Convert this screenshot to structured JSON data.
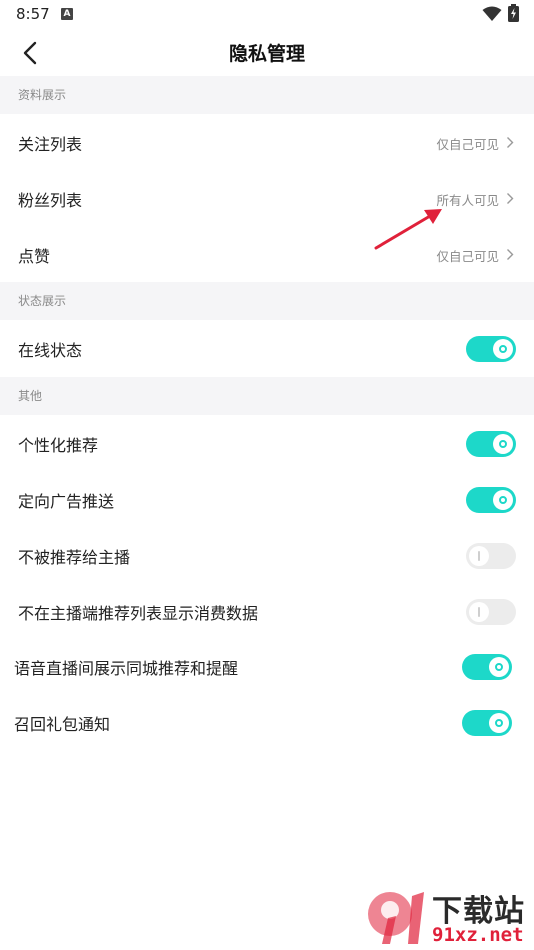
{
  "status_bar": {
    "time": "8:57",
    "app_icon_letter": "A"
  },
  "header": {
    "title": "隐私管理"
  },
  "sections": [
    {
      "title": "资料展示",
      "rows": [
        {
          "label": "关注列表",
          "value": "仅自己可见"
        },
        {
          "label": "粉丝列表",
          "value": "所有人可见"
        },
        {
          "label": "点赞",
          "value": "仅自己可见"
        }
      ]
    },
    {
      "title": "状态展示",
      "rows": [
        {
          "label": "在线状态",
          "toggle": true
        }
      ]
    },
    {
      "title": "其他",
      "rows": [
        {
          "label": "个性化推荐",
          "toggle": true
        },
        {
          "label": "定向广告推送",
          "toggle": true
        },
        {
          "label": "不被推荐给主播",
          "toggle": false
        },
        {
          "label": "不在主播端推荐列表显示消费数据",
          "toggle": false
        },
        {
          "label": "语音直播间展示同城推荐和提醒",
          "toggle": true
        },
        {
          "label": "召回礼包通知",
          "toggle": true
        }
      ]
    }
  ],
  "watermark": {
    "brand_cn": "下载站",
    "domain": "91xz.net"
  },
  "colors": {
    "toggle_on": "#1dd8c9",
    "toggle_off": "#ececec",
    "section_bg": "#f5f5f7",
    "annotation": "#e0213a"
  }
}
